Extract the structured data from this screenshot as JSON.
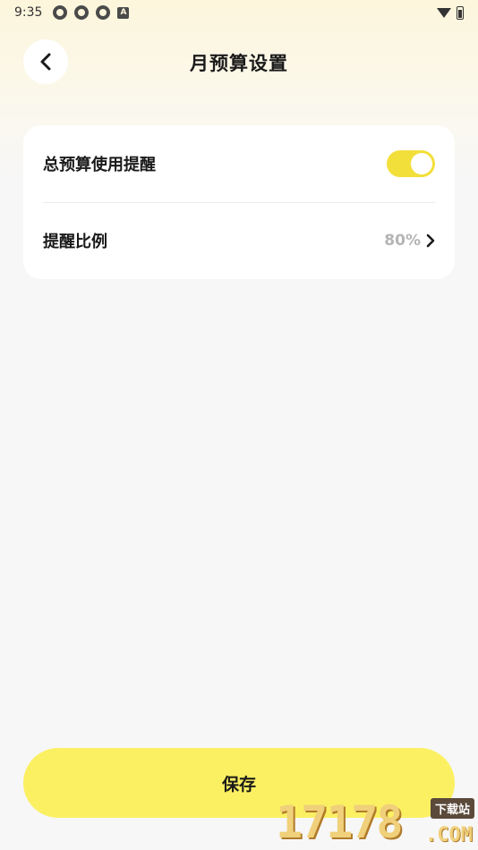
{
  "status_bar": {
    "time": "9:35",
    "notification_icons": [
      "app-notification-icon",
      "app-notification-icon",
      "app-notification-icon",
      "a-badge-icon"
    ],
    "a_badge": "A",
    "right_icons": [
      "wifi-icon",
      "battery-icon"
    ]
  },
  "header": {
    "title": "月预算设置",
    "back_icon": "chevron-left-icon"
  },
  "settings": {
    "items": [
      {
        "label": "总预算使用提醒",
        "control": "toggle",
        "enabled": true
      },
      {
        "label": "提醒比例",
        "value": "80%",
        "trailing_icon": "chevron-right-icon"
      }
    ]
  },
  "footer": {
    "save_label": "保存"
  },
  "watermark": {
    "digits": "17178",
    "tag": "下载站",
    "suffix": ".COM"
  },
  "colors": {
    "accent_yellow": "#fbf062",
    "toggle_on": "#f2df3a",
    "background": "#f7f7f7",
    "header_tint": "#fdf6dc",
    "value_gray": "#b5b5b5"
  }
}
